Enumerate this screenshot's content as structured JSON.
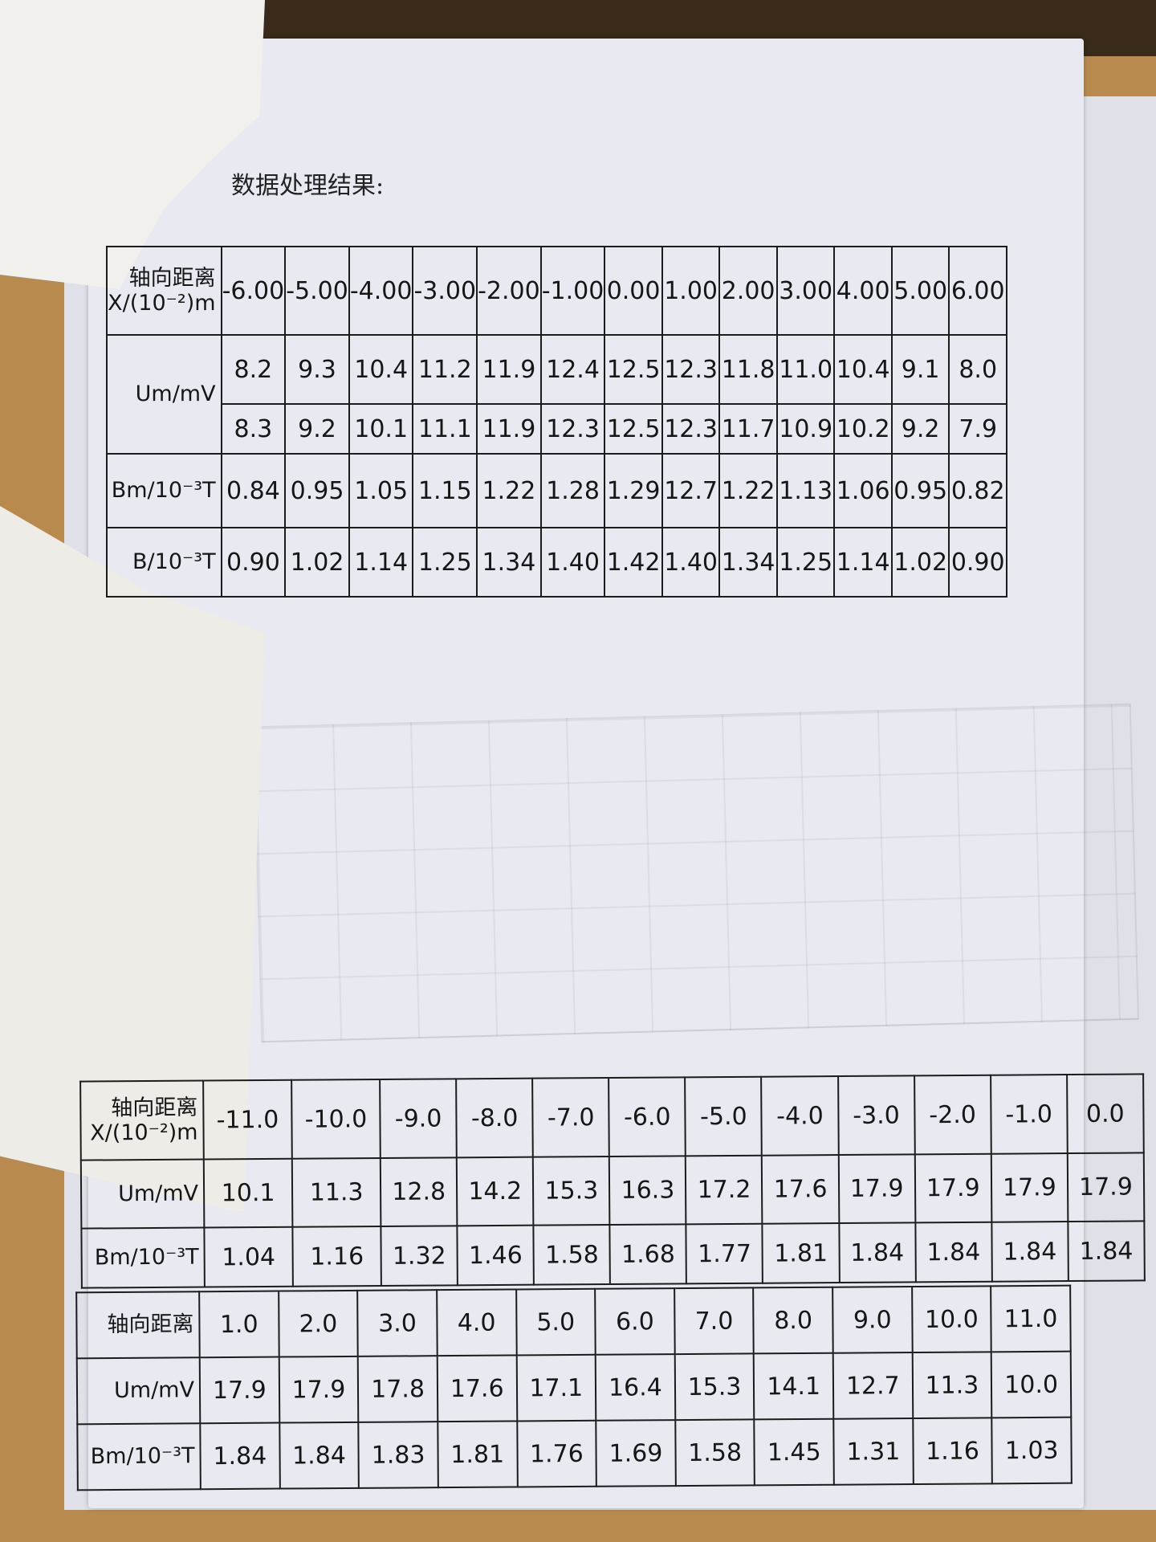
{
  "title": "数据处理结果:",
  "table1": {
    "header_label": [
      "轴向距离",
      "X/(10⁻²)m"
    ],
    "x": [
      "-6.00",
      "-5.00",
      "-4.00",
      "-3.00",
      "-2.00",
      "-1.00",
      "0.00",
      "1.00",
      "2.00",
      "3.00",
      "4.00",
      "5.00",
      "6.00"
    ],
    "um_label": "Um/mV",
    "um_row1": [
      "8.2",
      "9.3",
      "10.4",
      "11.2",
      "11.9",
      "12.4",
      "12.5",
      "12.3",
      "11.8",
      "11.0",
      "10.4",
      "9.1",
      "8.0"
    ],
    "um_row2": [
      "8.3",
      "9.2",
      "10.1",
      "11.1",
      "11.9",
      "12.3",
      "12.5",
      "12.3",
      "11.7",
      "10.9",
      "10.2",
      "9.2",
      "7.9"
    ],
    "bm_label": "Bm/10⁻³T",
    "bm": [
      "0.84",
      "0.95",
      "1.05",
      "1.15",
      "1.22",
      "1.28",
      "1.29",
      "12.7",
      "1.22",
      "1.13",
      "1.06",
      "0.95",
      "0.82"
    ],
    "b_label": "B/10⁻³T",
    "b": [
      "0.90",
      "1.02",
      "1.14",
      "1.25",
      "1.34",
      "1.40",
      "1.42",
      "1.40",
      "1.34",
      "1.25",
      "1.14",
      "1.02",
      "0.90"
    ]
  },
  "table2": {
    "header_label": [
      "轴向距离",
      "X/(10⁻²)m"
    ],
    "x": [
      "-11.0",
      "-10.0",
      "-9.0",
      "-8.0",
      "-7.0",
      "-6.0",
      "-5.0",
      "-4.0",
      "-3.0",
      "-2.0",
      "-1.0",
      "0.0"
    ],
    "um_label": "Um/mV",
    "um": [
      "10.1",
      "11.3",
      "12.8",
      "14.2",
      "15.3",
      "16.3",
      "17.2",
      "17.6",
      "17.9",
      "17.9",
      "17.9",
      "17.9"
    ],
    "bm_label": "Bm/10⁻³T",
    "bm": [
      "1.04",
      "1.16",
      "1.32",
      "1.46",
      "1.58",
      "1.68",
      "1.77",
      "1.81",
      "1.84",
      "1.84",
      "1.84",
      "1.84"
    ]
  },
  "table3": {
    "header_label": "轴向距离",
    "x": [
      "1.0",
      "2.0",
      "3.0",
      "4.0",
      "5.0",
      "6.0",
      "7.0",
      "8.0",
      "9.0",
      "10.0",
      "11.0"
    ],
    "um_label": "Um/mV",
    "um": [
      "17.9",
      "17.9",
      "17.8",
      "17.6",
      "17.1",
      "16.4",
      "15.3",
      "14.1",
      "12.7",
      "11.3",
      "10.0"
    ],
    "bm_label": "Bm/10⁻³T",
    "bm": [
      "1.84",
      "1.84",
      "1.83",
      "1.81",
      "1.76",
      "1.69",
      "1.58",
      "1.45",
      "1.31",
      "1.16",
      "1.03"
    ]
  }
}
